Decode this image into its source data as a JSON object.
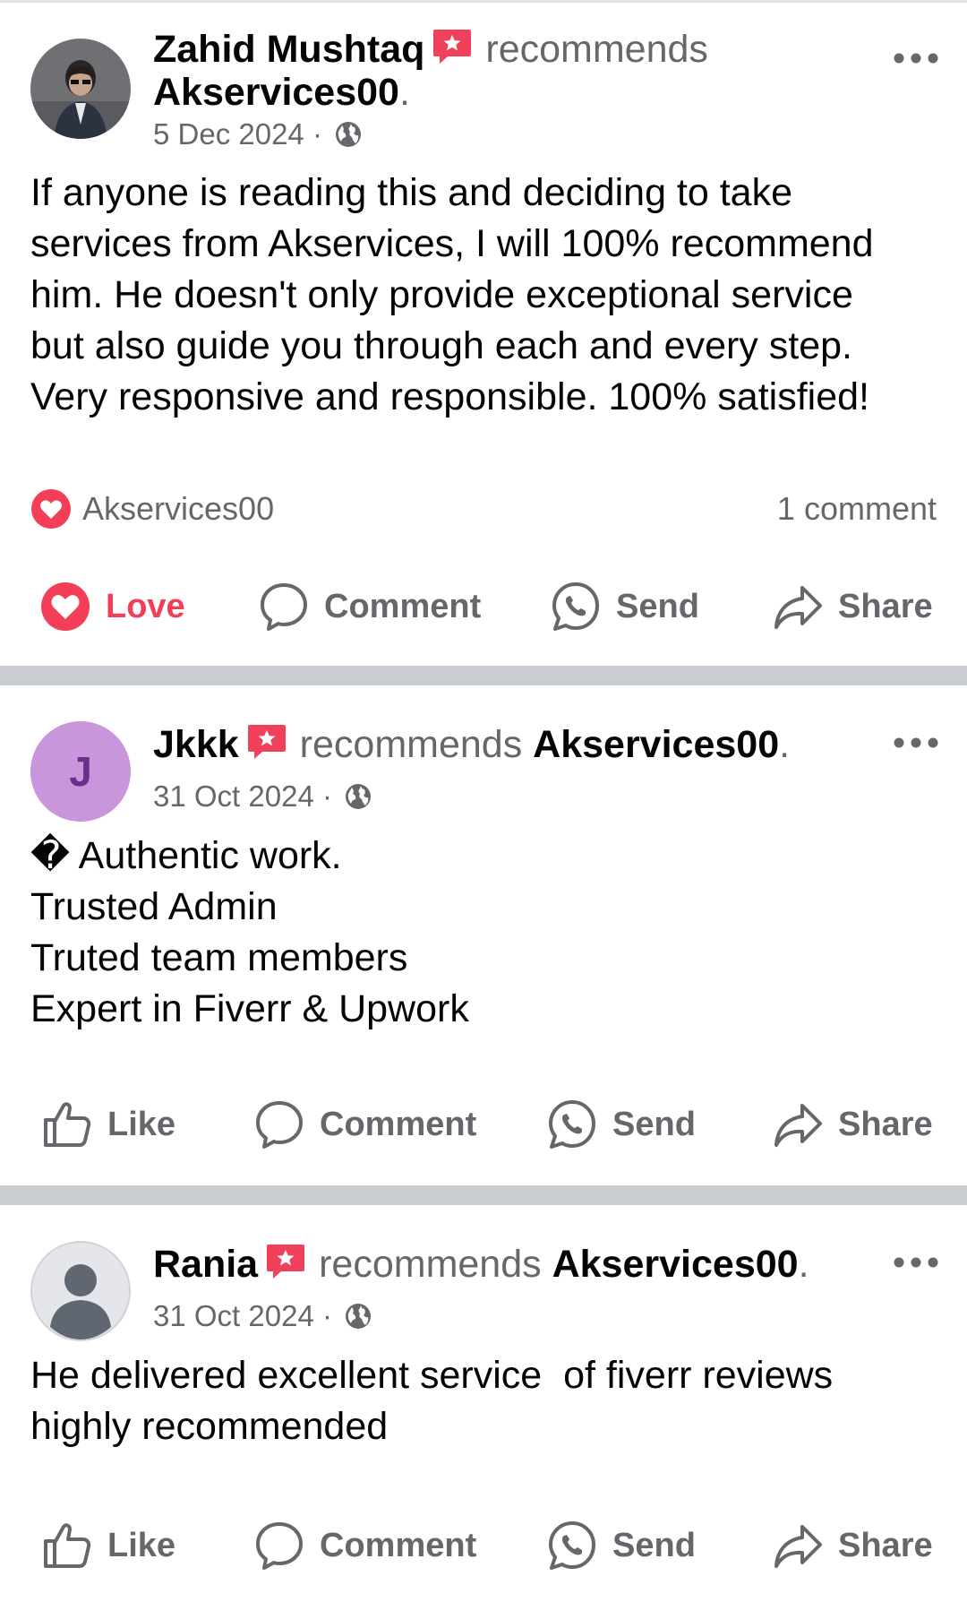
{
  "posts": [
    {
      "author": "Zahid Mushtaq",
      "recommends_text": "recommends",
      "page_name": "Akservices00",
      "page_suffix": ".",
      "date": "5 Dec 2024",
      "date_sep": "·",
      "body_lines": [
        "If anyone is reading this and deciding to take",
        "services from Akservices, I will 100% recommend",
        "him. He doesn't only provide exceptional service",
        "but also guide you through each and every step.",
        "Very responsive and responsible. 100% satisfied!"
      ],
      "reaction_by": "Akservices00",
      "comment_count": "1 comment",
      "actions": {
        "react": "Love",
        "comment": "Comment",
        "send": "Send",
        "share": "Share"
      }
    },
    {
      "author": "Jkkk",
      "avatar_letter": "J",
      "recommends_text": "recommends",
      "page_name": "Akservices00",
      "page_suffix": ".",
      "date": "31 Oct 2024",
      "date_sep": "·",
      "body_lines": [
        "� Authentic work.",
        "Trusted Admin",
        "Truted team members",
        "Expert in Fiverr & Upwork"
      ],
      "actions": {
        "react": "Like",
        "comment": "Comment",
        "send": "Send",
        "share": "Share"
      }
    },
    {
      "author": "Rania",
      "recommends_text": "recommends",
      "page_name": "Akservices00",
      "page_suffix": ".",
      "date": "31 Oct 2024",
      "date_sep": "·",
      "body_lines": [
        "He delivered excellent service  of fiverr reviews",
        "highly recommended"
      ],
      "actions": {
        "react": "Like",
        "comment": "Comment",
        "send": "Send",
        "share": "Share"
      }
    }
  ],
  "colors": {
    "text": "#050505",
    "secondary": "#65676b",
    "love": "#f33e58",
    "separator": "#c9ccd1",
    "avatar_j_bg": "#c996db",
    "avatar_j_fg": "#6b2f8f",
    "badge": "#f0405b"
  },
  "icons": [
    "recommend-badge-icon",
    "globe-icon",
    "more-options-icon",
    "love-reaction-icon",
    "like-icon",
    "comment-icon",
    "messenger-send-icon",
    "share-icon"
  ]
}
